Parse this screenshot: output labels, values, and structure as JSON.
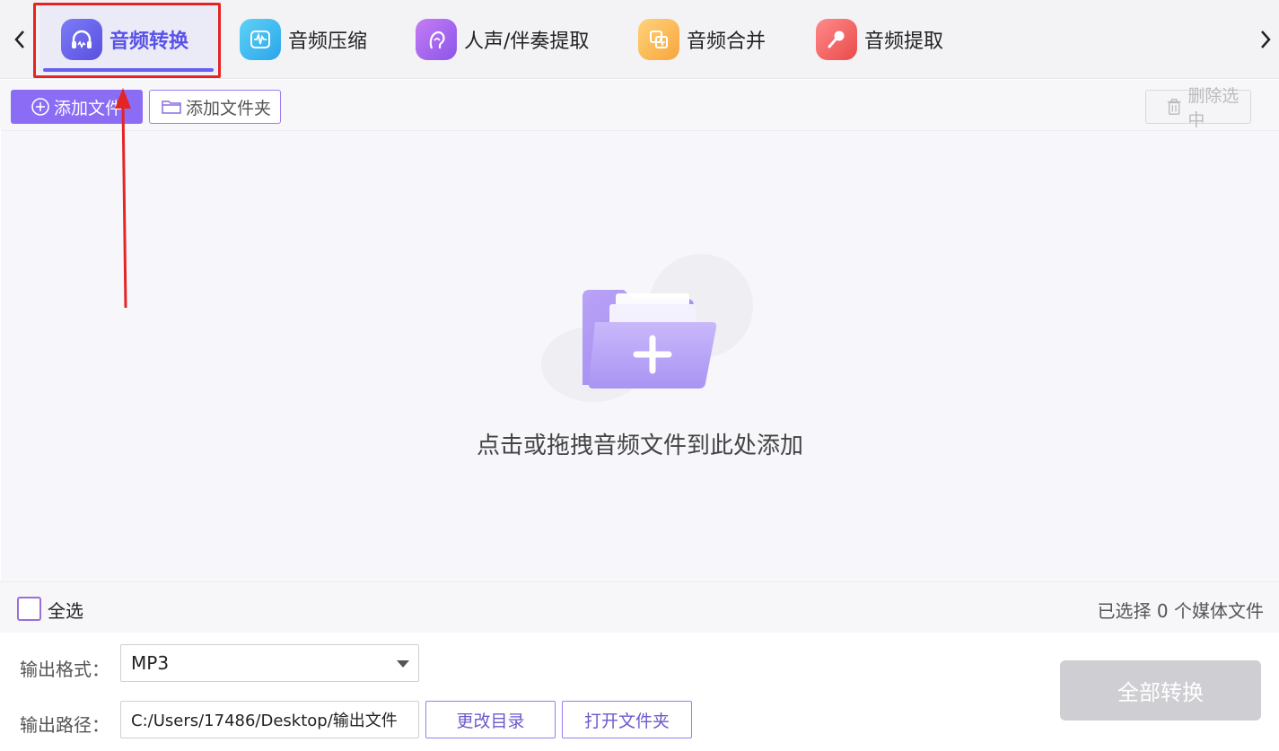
{
  "tabs": [
    {
      "label": "音频转换",
      "icon": "headphones-icon",
      "active": true
    },
    {
      "label": "音频压缩",
      "icon": "waveform-icon",
      "active": false
    },
    {
      "label": "人声/伴奏提取",
      "icon": "voice-profile-icon",
      "active": false
    },
    {
      "label": "音频合并",
      "icon": "merge-audio-icon",
      "active": false
    },
    {
      "label": "音频提取",
      "icon": "microphone-icon",
      "active": false
    }
  ],
  "toolbar": {
    "add_file_label": "添加文件",
    "add_folder_label": "添加文件夹",
    "delete_selected_label": "删除选中"
  },
  "dropzone": {
    "hint": "点击或拖拽音频文件到此处添加"
  },
  "selection": {
    "select_all_label": "全选",
    "selected_count_text": "已选择 0 个媒体文件"
  },
  "output": {
    "format_label": "输出格式：",
    "format_value": "MP3",
    "path_label": "输出路径：",
    "path_value": "C:/Users/17486/Desktop/输出文件",
    "change_dir_label": "更改目录",
    "open_folder_label": "打开文件夹",
    "convert_all_label": "全部转换"
  },
  "colors": {
    "accent": "#8b6cf5",
    "active_tab_text": "#5a52e8",
    "annotation": "#e52424",
    "disabled_button": "#cfcfd3"
  }
}
